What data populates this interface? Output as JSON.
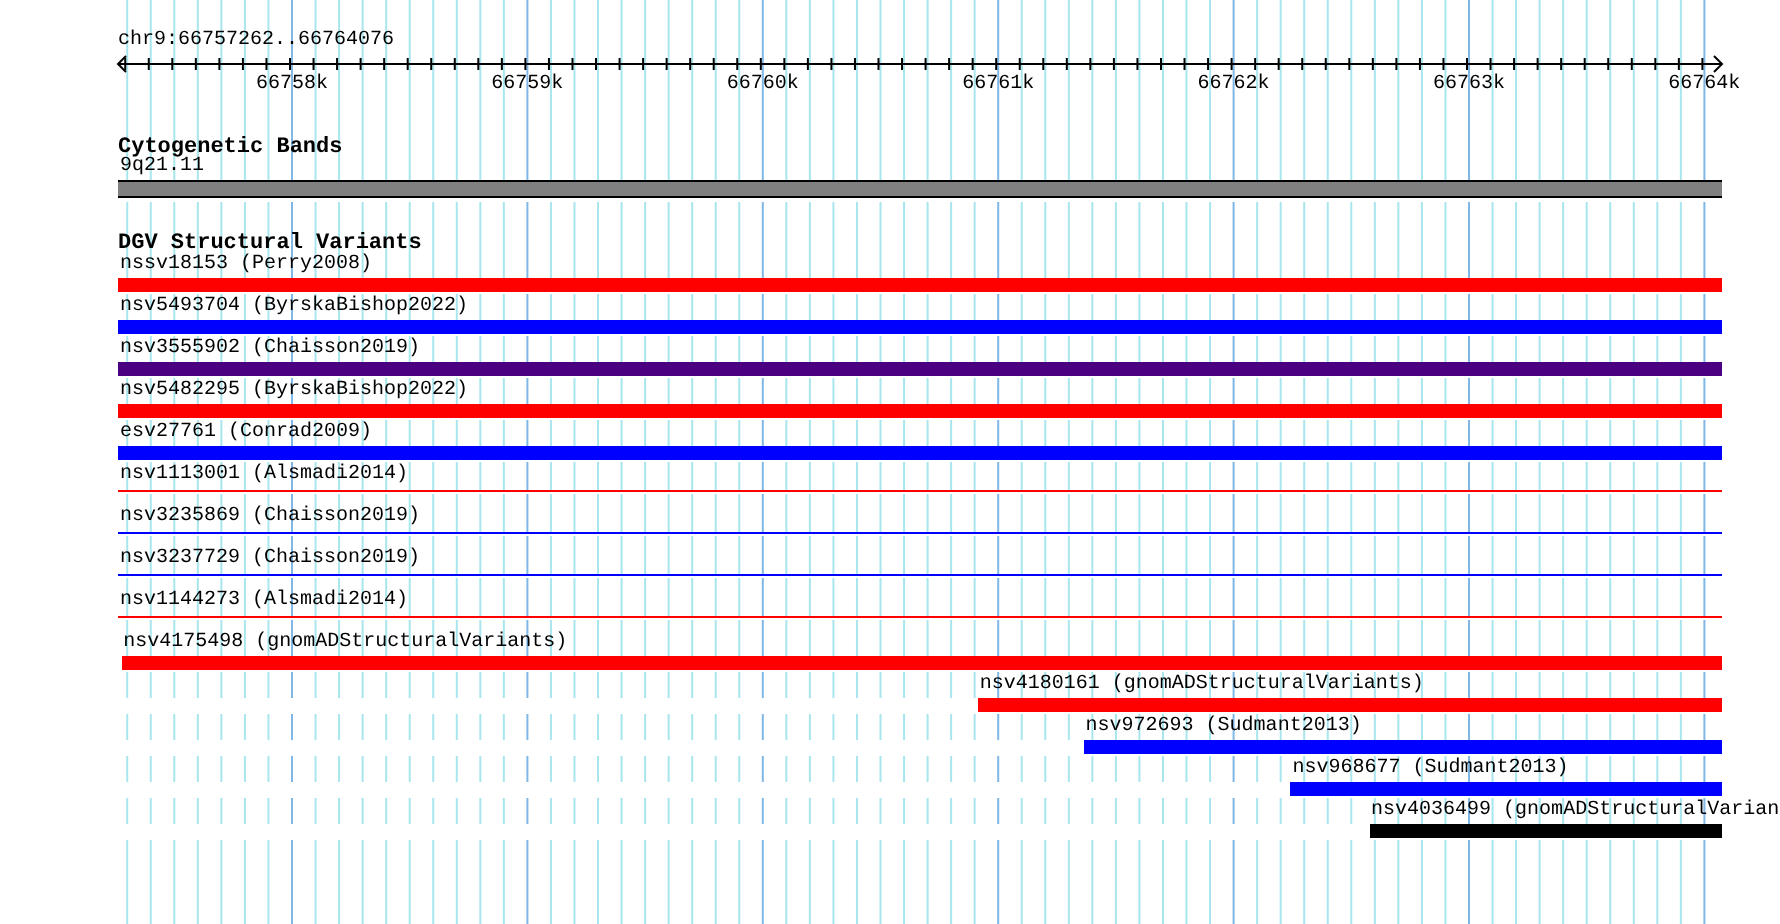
{
  "ruler": {
    "title": "chr9:66757262..66764076",
    "ticks": [
      "66758k",
      "66759k",
      "66760k",
      "66761k",
      "66762k",
      "66763k",
      "66764k"
    ]
  },
  "tracks": [
    {
      "title": "Cytogenetic Bands",
      "features": [
        {
          "label": "9q21.11",
          "kind": "band",
          "level": 1
        }
      ]
    },
    {
      "title": "DGV Structural Variants",
      "features": [
        {
          "label": "nssv18153 (Perry2008)",
          "kind": "bar",
          "color": "#ff0000",
          "level": 1
        },
        {
          "label": "nsv5493704 (ByrskaBishop2022)",
          "kind": "bar",
          "color": "#0000ff",
          "level": 1
        },
        {
          "label": "nsv3555902 (Chaisson2019)",
          "kind": "bar",
          "color": "#4b0082",
          "level": 1
        },
        {
          "label": "nsv5482295 (ByrskaBishop2022)",
          "kind": "bar",
          "color": "#ff0000",
          "level": 1
        },
        {
          "label": "esv27761 (Conrad2009)",
          "kind": "bar",
          "color": "#0000ff",
          "level": 1
        },
        {
          "label": "nsv1113001 (Alsmadi2014)",
          "kind": "line",
          "color": "#ff0000",
          "level": 1
        },
        {
          "label": "nsv3235869 (Chaisson2019)",
          "kind": "line",
          "color": "#0000ff",
          "level": 1
        },
        {
          "label": "nsv3237729 (Chaisson2019)",
          "kind": "line",
          "color": "#0000ff",
          "level": 1
        },
        {
          "label": "nsv1144273 (Alsmadi2014)",
          "kind": "line",
          "color": "#ff0000",
          "level": 1
        },
        {
          "label": "nsv4175498 (gnomADStructuralVariants)",
          "kind": "bar",
          "color": "#ff0000",
          "level": 0.998
        },
        {
          "label": "nsv4180161 (gnomADStructuralVariants)",
          "kind": "bar",
          "color": "#ff0000",
          "level": 0.464
        },
        {
          "label": "nsv972693 (Sudmant2013)",
          "kind": "bar",
          "color": "#0000ff",
          "level": 0.398
        },
        {
          "label": "nsv968677 (Sudmant2013)",
          "kind": "bar",
          "color": "#0000ff",
          "level": 0.269
        },
        {
          "label": "nsv4036499 (gnomADStructuralVarian",
          "kind": "bar",
          "color": "#000000",
          "level": 0.22
        }
      ]
    }
  ]
}
